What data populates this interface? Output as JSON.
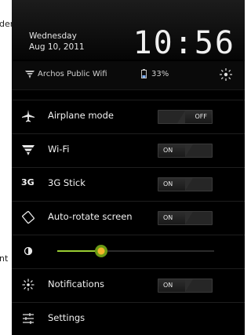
{
  "background": {
    "fragment_1": "den",
    "fragment_2": "nt"
  },
  "header": {
    "day": "Wednesday",
    "date": "Aug 10, 2011",
    "time": "10:56"
  },
  "status": {
    "network": "Archos Public Wifi",
    "battery": "33%"
  },
  "settings": [
    {
      "label": "Airplane mode",
      "icon": "airplane-icon",
      "state": "OFF"
    },
    {
      "label": "Wi-Fi",
      "icon": "wifi-icon",
      "state": "ON"
    },
    {
      "label": "3G Stick",
      "icon": "3g-icon",
      "icon_text": "3G",
      "state": "ON"
    },
    {
      "label": "Auto-rotate screen",
      "icon": "rotate-icon",
      "state": "ON"
    },
    {
      "label": "Notifications",
      "icon": "notification-icon",
      "state": "ON"
    },
    {
      "label": "Settings",
      "icon": "settings-sliders-icon"
    }
  ],
  "brightness": {
    "icon": "brightness-icon",
    "level": 0.28
  },
  "colors": {
    "accent_green": "#99cc33",
    "panel_bg": "#000000"
  }
}
